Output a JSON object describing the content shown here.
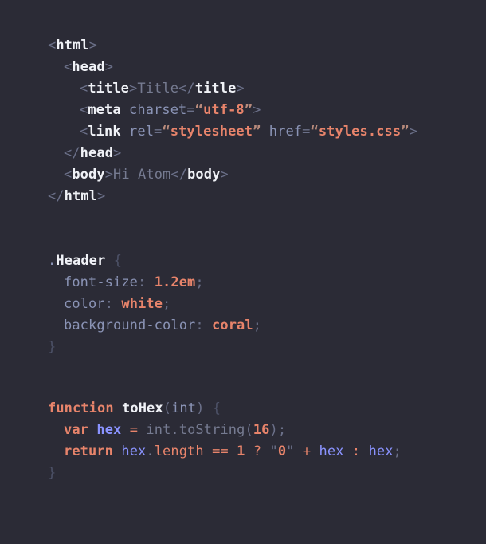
{
  "editor": {
    "theme_name": "one-dark",
    "background_color": "#2b2b36",
    "colors": {
      "tag": "#f0f2f7",
      "attribute": "#8a93b5",
      "string": "#e8846b",
      "punctuation": "#6b7089",
      "text": "#767b91",
      "keyword": "#e8846b",
      "variable": "#8a93ff",
      "number": "#e8846b",
      "dim_brace": "#4d5268"
    }
  },
  "html_block": {
    "language": "html",
    "lines": [
      {
        "indent": 0,
        "tokens": [
          {
            "t": "<",
            "c": "punct"
          },
          {
            "t": "html",
            "c": "tag"
          },
          {
            "t": ">",
            "c": "punct"
          }
        ]
      },
      {
        "indent": 1,
        "tokens": [
          {
            "t": "<",
            "c": "punct"
          },
          {
            "t": "head",
            "c": "tag"
          },
          {
            "t": ">",
            "c": "punct"
          }
        ]
      },
      {
        "indent": 2,
        "tokens": [
          {
            "t": "<",
            "c": "punct"
          },
          {
            "t": "title",
            "c": "tag"
          },
          {
            "t": ">",
            "c": "punct"
          },
          {
            "t": "Title",
            "c": "text"
          },
          {
            "t": "</",
            "c": "punct"
          },
          {
            "t": "title",
            "c": "tag"
          },
          {
            "t": ">",
            "c": "punct"
          }
        ]
      },
      {
        "indent": 2,
        "tokens": [
          {
            "t": "<",
            "c": "punct"
          },
          {
            "t": "meta",
            "c": "tag"
          },
          {
            "t": " ",
            "c": "punct"
          },
          {
            "t": "charset",
            "c": "attr"
          },
          {
            "t": "=",
            "c": "eq"
          },
          {
            "t": "“",
            "c": "strq"
          },
          {
            "t": "utf-8",
            "c": "str"
          },
          {
            "t": "”",
            "c": "strq"
          },
          {
            "t": ">",
            "c": "punct"
          }
        ]
      },
      {
        "indent": 2,
        "tokens": [
          {
            "t": "<",
            "c": "punct"
          },
          {
            "t": "link",
            "c": "tag"
          },
          {
            "t": " ",
            "c": "punct"
          },
          {
            "t": "rel",
            "c": "attr"
          },
          {
            "t": "=",
            "c": "eq"
          },
          {
            "t": "“",
            "c": "strq"
          },
          {
            "t": "stylesheet",
            "c": "str"
          },
          {
            "t": "”",
            "c": "strq"
          },
          {
            "t": " ",
            "c": "punct"
          },
          {
            "t": "href",
            "c": "attr"
          },
          {
            "t": "=",
            "c": "eq"
          },
          {
            "t": "“",
            "c": "strq"
          },
          {
            "t": "styles.css",
            "c": "str"
          },
          {
            "t": "”",
            "c": "strq"
          },
          {
            "t": ">",
            "c": "punct"
          }
        ]
      },
      {
        "indent": 1,
        "tokens": [
          {
            "t": "</",
            "c": "punct"
          },
          {
            "t": "head",
            "c": "tag"
          },
          {
            "t": ">",
            "c": "punct"
          }
        ]
      },
      {
        "indent": 1,
        "tokens": [
          {
            "t": "<",
            "c": "punct"
          },
          {
            "t": "body",
            "c": "tag"
          },
          {
            "t": ">",
            "c": "punct"
          },
          {
            "t": "Hi Atom",
            "c": "text"
          },
          {
            "t": "</",
            "c": "punct"
          },
          {
            "t": "body",
            "c": "tag"
          },
          {
            "t": ">",
            "c": "punct"
          }
        ]
      },
      {
        "indent": 0,
        "tokens": [
          {
            "t": "</",
            "c": "punct"
          },
          {
            "t": "html",
            "c": "tag"
          },
          {
            "t": ">",
            "c": "punct"
          }
        ]
      }
    ]
  },
  "css_block": {
    "language": "css",
    "lines": [
      {
        "indent": 0,
        "tokens": [
          {
            "t": ".",
            "c": "dot"
          },
          {
            "t": "Header",
            "c": "sel"
          },
          {
            "t": " ",
            "c": "punct"
          },
          {
            "t": "{",
            "c": "brace-dim"
          }
        ]
      },
      {
        "indent": 1,
        "tokens": [
          {
            "t": "font-size",
            "c": "prop"
          },
          {
            "t": ": ",
            "c": "punct"
          },
          {
            "t": "1.2em",
            "c": "val"
          },
          {
            "t": ";",
            "c": "semi"
          }
        ]
      },
      {
        "indent": 1,
        "tokens": [
          {
            "t": "color",
            "c": "prop"
          },
          {
            "t": ": ",
            "c": "punct"
          },
          {
            "t": "white",
            "c": "val"
          },
          {
            "t": ";",
            "c": "semi"
          }
        ]
      },
      {
        "indent": 1,
        "tokens": [
          {
            "t": "background-color",
            "c": "prop"
          },
          {
            "t": ": ",
            "c": "punct"
          },
          {
            "t": "coral",
            "c": "val"
          },
          {
            "t": ";",
            "c": "semi"
          }
        ]
      },
      {
        "indent": 0,
        "tokens": [
          {
            "t": "}",
            "c": "brace-dim"
          }
        ]
      }
    ]
  },
  "js_block": {
    "language": "javascript",
    "lines": [
      {
        "indent": 0,
        "tokens": [
          {
            "t": "function",
            "c": "kw"
          },
          {
            "t": " ",
            "c": "punct"
          },
          {
            "t": "toHex",
            "c": "fn"
          },
          {
            "t": "(",
            "c": "punct"
          },
          {
            "t": "int",
            "c": "attr"
          },
          {
            "t": ")",
            "c": "punct"
          },
          {
            "t": " ",
            "c": "punct"
          },
          {
            "t": "{",
            "c": "brace-dim"
          }
        ]
      },
      {
        "indent": 1,
        "tokens": [
          {
            "t": "var",
            "c": "kw"
          },
          {
            "t": " ",
            "c": "punct"
          },
          {
            "t": "hex",
            "c": "varname"
          },
          {
            "t": " ",
            "c": "punct"
          },
          {
            "t": "=",
            "c": "op"
          },
          {
            "t": " ",
            "c": "punct"
          },
          {
            "t": "int",
            "c": "ident"
          },
          {
            "t": ".",
            "c": "ident"
          },
          {
            "t": "toString",
            "c": "ident"
          },
          {
            "t": "(",
            "c": "punct"
          },
          {
            "t": "16",
            "c": "num"
          },
          {
            "t": ")",
            "c": "punct"
          },
          {
            "t": ";",
            "c": "semi"
          }
        ]
      },
      {
        "indent": 1,
        "tokens": [
          {
            "t": "return",
            "c": "kw"
          },
          {
            "t": " ",
            "c": "punct"
          },
          {
            "t": "hex",
            "c": "varuse"
          },
          {
            "t": ".",
            "c": "ident"
          },
          {
            "t": "length",
            "c": "member"
          },
          {
            "t": " ",
            "c": "punct"
          },
          {
            "t": "==",
            "c": "op"
          },
          {
            "t": " ",
            "c": "punct"
          },
          {
            "t": "1",
            "c": "num"
          },
          {
            "t": " ",
            "c": "punct"
          },
          {
            "t": "?",
            "c": "op"
          },
          {
            "t": " ",
            "c": "punct"
          },
          {
            "t": "\"",
            "c": "punct"
          },
          {
            "t": "0",
            "c": "str"
          },
          {
            "t": "\"",
            "c": "punct"
          },
          {
            "t": " ",
            "c": "punct"
          },
          {
            "t": "+",
            "c": "op"
          },
          {
            "t": " ",
            "c": "punct"
          },
          {
            "t": "hex",
            "c": "varuse"
          },
          {
            "t": " ",
            "c": "punct"
          },
          {
            "t": ":",
            "c": "op"
          },
          {
            "t": " ",
            "c": "punct"
          },
          {
            "t": "hex",
            "c": "varuse"
          },
          {
            "t": ";",
            "c": "semi"
          }
        ]
      },
      {
        "indent": 0,
        "tokens": [
          {
            "t": "}",
            "c": "brace-dim"
          }
        ]
      }
    ]
  }
}
